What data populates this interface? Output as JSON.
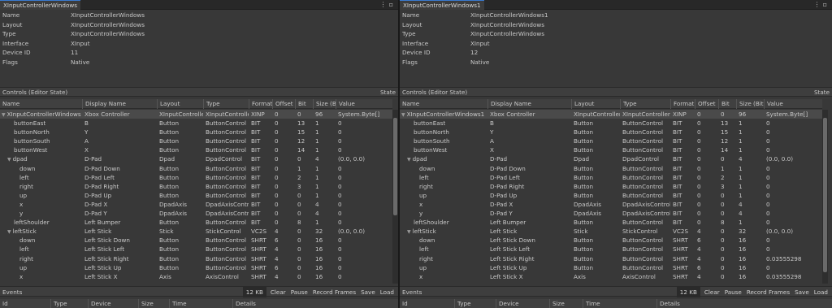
{
  "windows": [
    {
      "tab": "XInputControllerWindows",
      "props": [
        {
          "label": "Name",
          "value": "XInputControllerWindows"
        },
        {
          "label": "Layout",
          "value": "XInputControllerWindows"
        },
        {
          "label": "Type",
          "value": "XInputControllerWindows"
        },
        {
          "label": "Interface",
          "value": "XInput"
        },
        {
          "label": "Device ID",
          "value": "11"
        },
        {
          "label": "Flags",
          "value": "Native"
        }
      ],
      "section_title": "Controls (Editor State)",
      "section_right": "State",
      "columns": [
        "Name",
        "Display Name",
        "Layout",
        "Type",
        "Format",
        "Offset",
        "Bit",
        "Size (Bi",
        "Value"
      ],
      "rows": [
        {
          "exp": "▼",
          "indent": 0,
          "cells": [
            "XInputControllerWindows",
            "Xbox Controller",
            "XInputController",
            "XInputControllerW",
            "XINP",
            "0",
            "0",
            "96",
            "System.Byte[]"
          ]
        },
        {
          "exp": "",
          "indent": 1,
          "cells": [
            "buttonEast",
            "B",
            "Button",
            "ButtonControl",
            "BIT",
            "0",
            "13",
            "1",
            "0"
          ]
        },
        {
          "exp": "",
          "indent": 1,
          "cells": [
            "buttonNorth",
            "Y",
            "Button",
            "ButtonControl",
            "BIT",
            "0",
            "15",
            "1",
            "0"
          ]
        },
        {
          "exp": "",
          "indent": 1,
          "cells": [
            "buttonSouth",
            "A",
            "Button",
            "ButtonControl",
            "BIT",
            "0",
            "12",
            "1",
            "0"
          ]
        },
        {
          "exp": "",
          "indent": 1,
          "cells": [
            "buttonWest",
            "X",
            "Button",
            "ButtonControl",
            "BIT",
            "0",
            "14",
            "1",
            "0"
          ]
        },
        {
          "exp": "▼",
          "indent": 1,
          "cells": [
            "dpad",
            "D-Pad",
            "Dpad",
            "DpadControl",
            "BIT",
            "0",
            "0",
            "4",
            "(0.0, 0.0)"
          ]
        },
        {
          "exp": "",
          "indent": 2,
          "cells": [
            "down",
            "D-Pad Down",
            "Button",
            "ButtonControl",
            "BIT",
            "0",
            "1",
            "1",
            "0"
          ]
        },
        {
          "exp": "",
          "indent": 2,
          "cells": [
            "left",
            "D-Pad Left",
            "Button",
            "ButtonControl",
            "BIT",
            "0",
            "2",
            "1",
            "0"
          ]
        },
        {
          "exp": "",
          "indent": 2,
          "cells": [
            "right",
            "D-Pad Right",
            "Button",
            "ButtonControl",
            "BIT",
            "0",
            "3",
            "1",
            "0"
          ]
        },
        {
          "exp": "",
          "indent": 2,
          "cells": [
            "up",
            "D-Pad Up",
            "Button",
            "ButtonControl",
            "BIT",
            "0",
            "0",
            "1",
            "0"
          ]
        },
        {
          "exp": "",
          "indent": 2,
          "cells": [
            "x",
            "D-Pad X",
            "DpadAxis",
            "DpadAxisContro",
            "BIT",
            "0",
            "0",
            "4",
            "0"
          ]
        },
        {
          "exp": "",
          "indent": 2,
          "cells": [
            "y",
            "D-Pad Y",
            "DpadAxis",
            "DpadAxisContro",
            "BIT",
            "0",
            "0",
            "4",
            "0"
          ]
        },
        {
          "exp": "",
          "indent": 1,
          "cells": [
            "leftShoulder",
            "Left Bumper",
            "Button",
            "ButtonControl",
            "BIT",
            "0",
            "8",
            "1",
            "0"
          ]
        },
        {
          "exp": "▼",
          "indent": 1,
          "cells": [
            "leftStick",
            "Left Stick",
            "Stick",
            "StickControl",
            "VC2S",
            "4",
            "0",
            "32",
            "(0.0, 0.0)"
          ]
        },
        {
          "exp": "",
          "indent": 2,
          "cells": [
            "down",
            "Left Stick Down",
            "Button",
            "ButtonControl",
            "SHRT",
            "6",
            "0",
            "16",
            "0"
          ]
        },
        {
          "exp": "",
          "indent": 2,
          "cells": [
            "left",
            "Left Stick Left",
            "Button",
            "ButtonControl",
            "SHRT",
            "4",
            "0",
            "16",
            "0"
          ]
        },
        {
          "exp": "",
          "indent": 2,
          "cells": [
            "right",
            "Left Stick Right",
            "Button",
            "ButtonControl",
            "SHRT",
            "4",
            "0",
            "16",
            "0"
          ]
        },
        {
          "exp": "",
          "indent": 2,
          "cells": [
            "up",
            "Left Stick Up",
            "Button",
            "ButtonControl",
            "SHRT",
            "6",
            "0",
            "16",
            "0"
          ]
        },
        {
          "exp": "",
          "indent": 2,
          "cells": [
            "x",
            "Left Stick X",
            "Axis",
            "AxisControl",
            "SHRT",
            "4",
            "0",
            "16",
            "0"
          ]
        }
      ],
      "events_title": "Events",
      "events_size": "12 KB",
      "events_buttons": [
        "Clear",
        "Pause",
        "Record Frames",
        "Save",
        "Load"
      ],
      "event_columns": [
        "Id",
        "Type",
        "Device",
        "Size",
        "Time",
        "Details"
      ]
    },
    {
      "tab": "XInputControllerWindows1",
      "props": [
        {
          "label": "Name",
          "value": "XInputControllerWindows1"
        },
        {
          "label": "Layout",
          "value": "XInputControllerWindows"
        },
        {
          "label": "Type",
          "value": "XInputControllerWindows"
        },
        {
          "label": "Interface",
          "value": "XInput"
        },
        {
          "label": "Device ID",
          "value": "12"
        },
        {
          "label": "Flags",
          "value": "Native"
        }
      ],
      "section_title": "Controls (Editor State)",
      "section_right": "State",
      "columns": [
        "Name",
        "Display Name",
        "Layout",
        "Type",
        "Format",
        "Offset",
        "Bit",
        "Size (Bit",
        "Value"
      ],
      "rows": [
        {
          "exp": "▼",
          "indent": 0,
          "cells": [
            "XInputControllerWindows1",
            "Xbox Controller",
            "XInputControllerW",
            "XInputControllerW",
            "XINP",
            "0",
            "0",
            "96",
            "System.Byte[]"
          ]
        },
        {
          "exp": "",
          "indent": 1,
          "cells": [
            "buttonEast",
            "B",
            "Button",
            "ButtonControl",
            "BIT",
            "0",
            "13",
            "1",
            "0"
          ]
        },
        {
          "exp": "",
          "indent": 1,
          "cells": [
            "buttonNorth",
            "Y",
            "Button",
            "ButtonControl",
            "BIT",
            "0",
            "15",
            "1",
            "0"
          ]
        },
        {
          "exp": "",
          "indent": 1,
          "cells": [
            "buttonSouth",
            "A",
            "Button",
            "ButtonControl",
            "BIT",
            "0",
            "12",
            "1",
            "0"
          ]
        },
        {
          "exp": "",
          "indent": 1,
          "cells": [
            "buttonWest",
            "X",
            "Button",
            "ButtonControl",
            "BIT",
            "0",
            "14",
            "1",
            "0"
          ]
        },
        {
          "exp": "▼",
          "indent": 1,
          "cells": [
            "dpad",
            "D-Pad",
            "Dpad",
            "DpadControl",
            "BIT",
            "0",
            "0",
            "4",
            "(0.0, 0.0)"
          ]
        },
        {
          "exp": "",
          "indent": 2,
          "cells": [
            "down",
            "D-Pad Down",
            "Button",
            "ButtonControl",
            "BIT",
            "0",
            "1",
            "1",
            "0"
          ]
        },
        {
          "exp": "",
          "indent": 2,
          "cells": [
            "left",
            "D-Pad Left",
            "Button",
            "ButtonControl",
            "BIT",
            "0",
            "2",
            "1",
            "0"
          ]
        },
        {
          "exp": "",
          "indent": 2,
          "cells": [
            "right",
            "D-Pad Right",
            "Button",
            "ButtonControl",
            "BIT",
            "0",
            "3",
            "1",
            "0"
          ]
        },
        {
          "exp": "",
          "indent": 2,
          "cells": [
            "up",
            "D-Pad Up",
            "Button",
            "ButtonControl",
            "BIT",
            "0",
            "0",
            "1",
            "0"
          ]
        },
        {
          "exp": "",
          "indent": 2,
          "cells": [
            "x",
            "D-Pad X",
            "DpadAxis",
            "DpadAxisControl",
            "BIT",
            "0",
            "0",
            "4",
            "0"
          ]
        },
        {
          "exp": "",
          "indent": 2,
          "cells": [
            "y",
            "D-Pad Y",
            "DpadAxis",
            "DpadAxisControl",
            "BIT",
            "0",
            "0",
            "4",
            "0"
          ]
        },
        {
          "exp": "",
          "indent": 1,
          "cells": [
            "leftShoulder",
            "Left Bumper",
            "Button",
            "ButtonControl",
            "BIT",
            "0",
            "8",
            "1",
            "0"
          ]
        },
        {
          "exp": "▼",
          "indent": 1,
          "cells": [
            "leftStick",
            "Left Stick",
            "Stick",
            "StickControl",
            "VC2S",
            "4",
            "0",
            "32",
            "(0.0, 0.0)"
          ]
        },
        {
          "exp": "",
          "indent": 2,
          "cells": [
            "down",
            "Left Stick Down",
            "Button",
            "ButtonControl",
            "SHRT",
            "6",
            "0",
            "16",
            "0"
          ]
        },
        {
          "exp": "",
          "indent": 2,
          "cells": [
            "left",
            "Left Stick Left",
            "Button",
            "ButtonControl",
            "SHRT",
            "4",
            "0",
            "16",
            "0"
          ]
        },
        {
          "exp": "",
          "indent": 2,
          "cells": [
            "right",
            "Left Stick Right",
            "Button",
            "ButtonControl",
            "SHRT",
            "4",
            "0",
            "16",
            "0.03555298"
          ]
        },
        {
          "exp": "",
          "indent": 2,
          "cells": [
            "up",
            "Left Stick Up",
            "Button",
            "ButtonControl",
            "SHRT",
            "6",
            "0",
            "16",
            "0"
          ]
        },
        {
          "exp": "",
          "indent": 2,
          "cells": [
            "x",
            "Left Stick X",
            "Axis",
            "AxisControl",
            "SHRT",
            "4",
            "0",
            "16",
            "0.03555298"
          ]
        }
      ],
      "events_title": "Events",
      "events_size": "12 KB",
      "events_buttons": [
        "Clear",
        "Pause",
        "Record Frames",
        "Save",
        "Load"
      ],
      "event_columns": [
        "Id",
        "Type",
        "Device",
        "Size",
        "Time",
        "Details"
      ]
    }
  ]
}
